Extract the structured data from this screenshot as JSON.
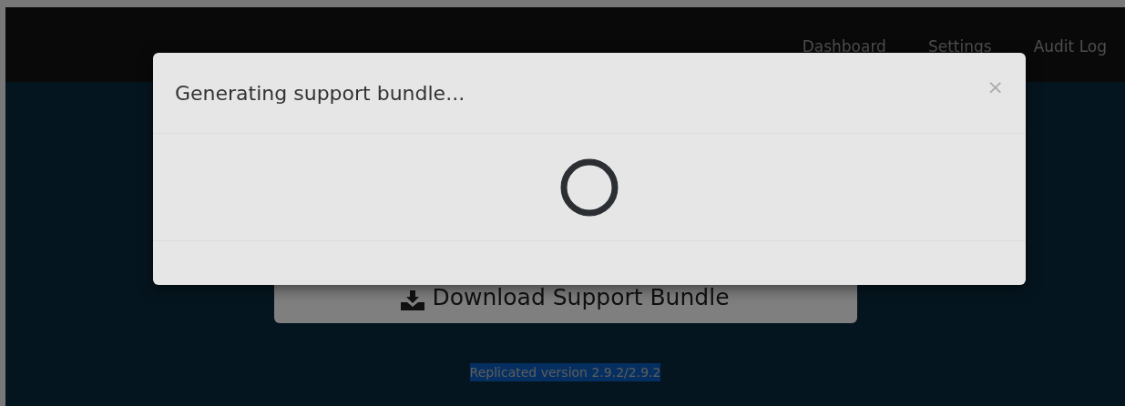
{
  "navbar": {
    "links": [
      {
        "label": "Dashboard"
      },
      {
        "label": "Settings"
      },
      {
        "label": "Audit Log"
      }
    ]
  },
  "main": {
    "download_button": {
      "label": "Download Support Bundle"
    },
    "version": {
      "text": "Replicated version 2.9.2/2.9.2",
      "highlighted": true
    }
  },
  "modal": {
    "title": "Generating support bundle...",
    "close": "×",
    "loading": true
  }
}
